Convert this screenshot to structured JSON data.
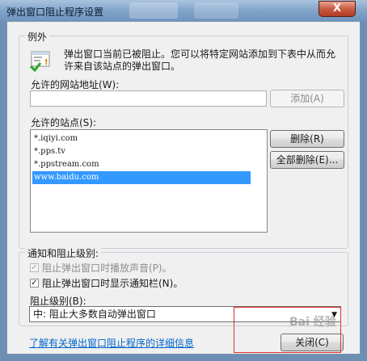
{
  "window": {
    "title": "弹出窗口阻止程序设置",
    "close_glyph": "X"
  },
  "exceptions": {
    "group_label": "例外",
    "description_line1": "弹出窗口当前已被阻止。您可以将特定网站添加到下表中从而允",
    "description_line2": "许来自该站点的弹出窗口。",
    "address_label": "允许的网站地址(W):",
    "address_value": "",
    "add_button": "添加(A)",
    "allowed_label": "允许的站点(S):",
    "sites": [
      "*.iqiyi.com",
      "*.pps.tv",
      "*.ppstream.com",
      "www.baidu.com"
    ],
    "selected_index": 3,
    "delete_button": "删除(R)",
    "delete_all_button": "全部删除(E)..."
  },
  "notify": {
    "group_label": "通知和阻止级别:",
    "sound_label": "阻止弹出窗口时播放声音(P)。",
    "sound_checked": true,
    "sound_disabled": true,
    "infobar_label": "阻止弹出窗口时显示通知栏(N)。",
    "infobar_checked": true,
    "level_label": "阻止级别(B):",
    "level_value": "中: 阻止大多数自动弹出窗口"
  },
  "footer": {
    "learn_more_link": "了解有关弹出窗口阻止程序的详细信息",
    "close_button": "关闭(C)",
    "watermark": "Bai 经验"
  }
}
